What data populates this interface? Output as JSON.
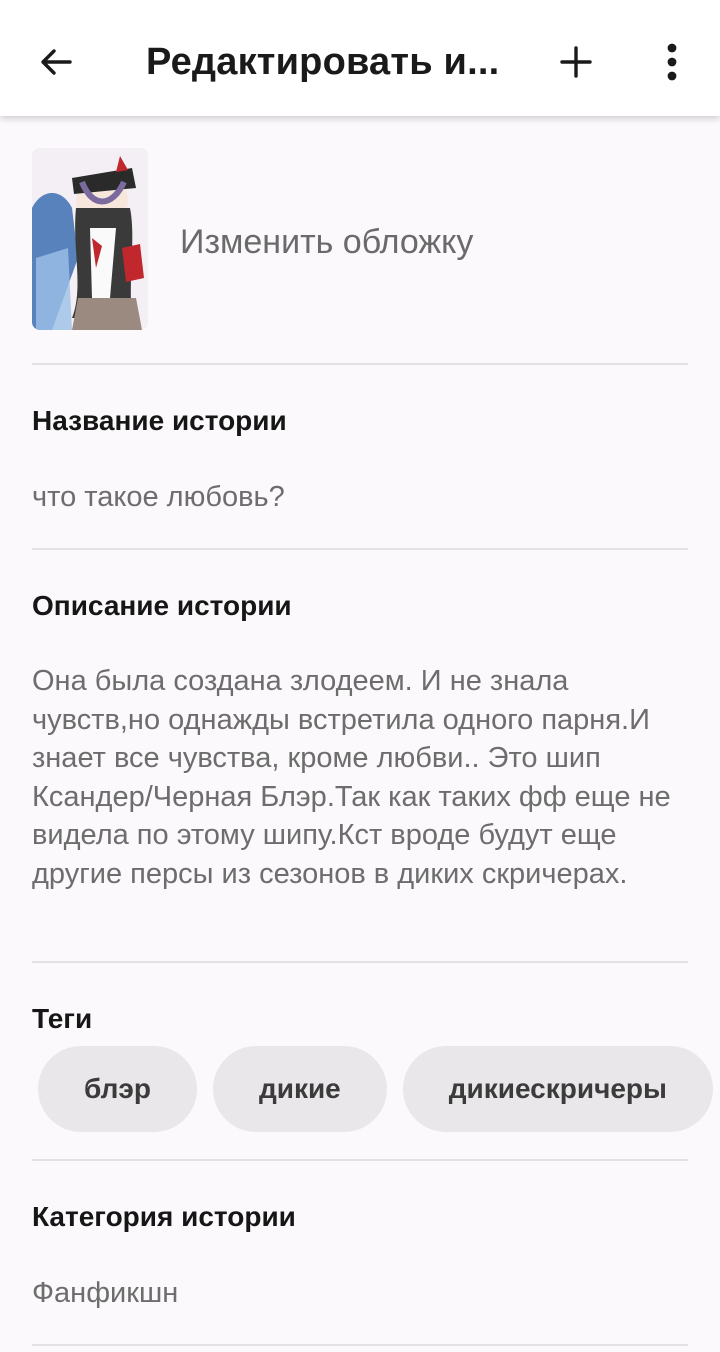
{
  "toolbar": {
    "title": "Редактировать и..."
  },
  "cover": {
    "change_label": "Изменить обложку"
  },
  "story_title": {
    "label": "Название истории",
    "value": "что такое любовь?"
  },
  "story_description": {
    "label": "Описание истории",
    "value": "Она была создана злодеем. И не знала чувств,но однажды встретила одного парня.И знает все чувства, кроме любви.. Это шип Ксандер/Черная Блэр.Так как таких фф еще не видела по этому шипу.Кст вроде будут еще другие персы из сезонов в диких скричерах."
  },
  "tags": {
    "label": "Теги",
    "items": [
      "блэр",
      "дикие",
      "дикиескричеры",
      ""
    ]
  },
  "category": {
    "label": "Категория истории",
    "value": "Фанфикшн"
  },
  "colors": {
    "background": "#fbf9fb",
    "topbar": "#ffffff",
    "tag_bg": "#e9e7e9",
    "muted_text": "#6d6d6d"
  },
  "icons": {
    "back": "arrow-left-icon",
    "add": "plus-icon",
    "more": "more-vertical-icon"
  }
}
